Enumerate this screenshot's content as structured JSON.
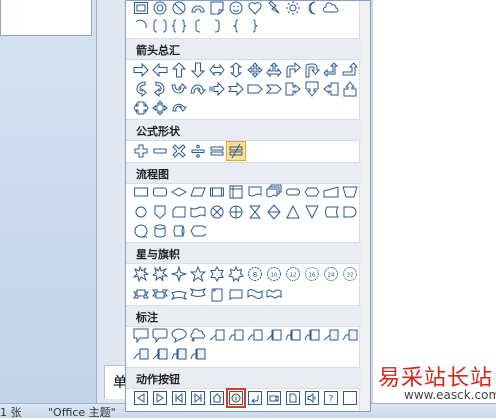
{
  "background": {
    "slide_tab_char": "单",
    "status_bar": {
      "slides": "1 张",
      "theme": "\"Office 主题\""
    }
  },
  "gallery": {
    "categories": [
      {
        "label": "箭头总汇"
      },
      {
        "label": "公式形状"
      },
      {
        "label": "流程图"
      },
      {
        "label": "星与旗帜"
      },
      {
        "label": "标注"
      },
      {
        "label": "动作按钮"
      }
    ],
    "star_numbers": [
      "8",
      "10",
      "12",
      "16",
      "24",
      "32"
    ],
    "action_selected_icon": "action-button-home-icon"
  },
  "watermark": {
    "text": "易采站长站",
    "url": "www.easck.com"
  },
  "colors": {
    "shape_stroke": "#2a5a92",
    "selection": "#e03a2f",
    "header_bg": "#e9edf3"
  }
}
